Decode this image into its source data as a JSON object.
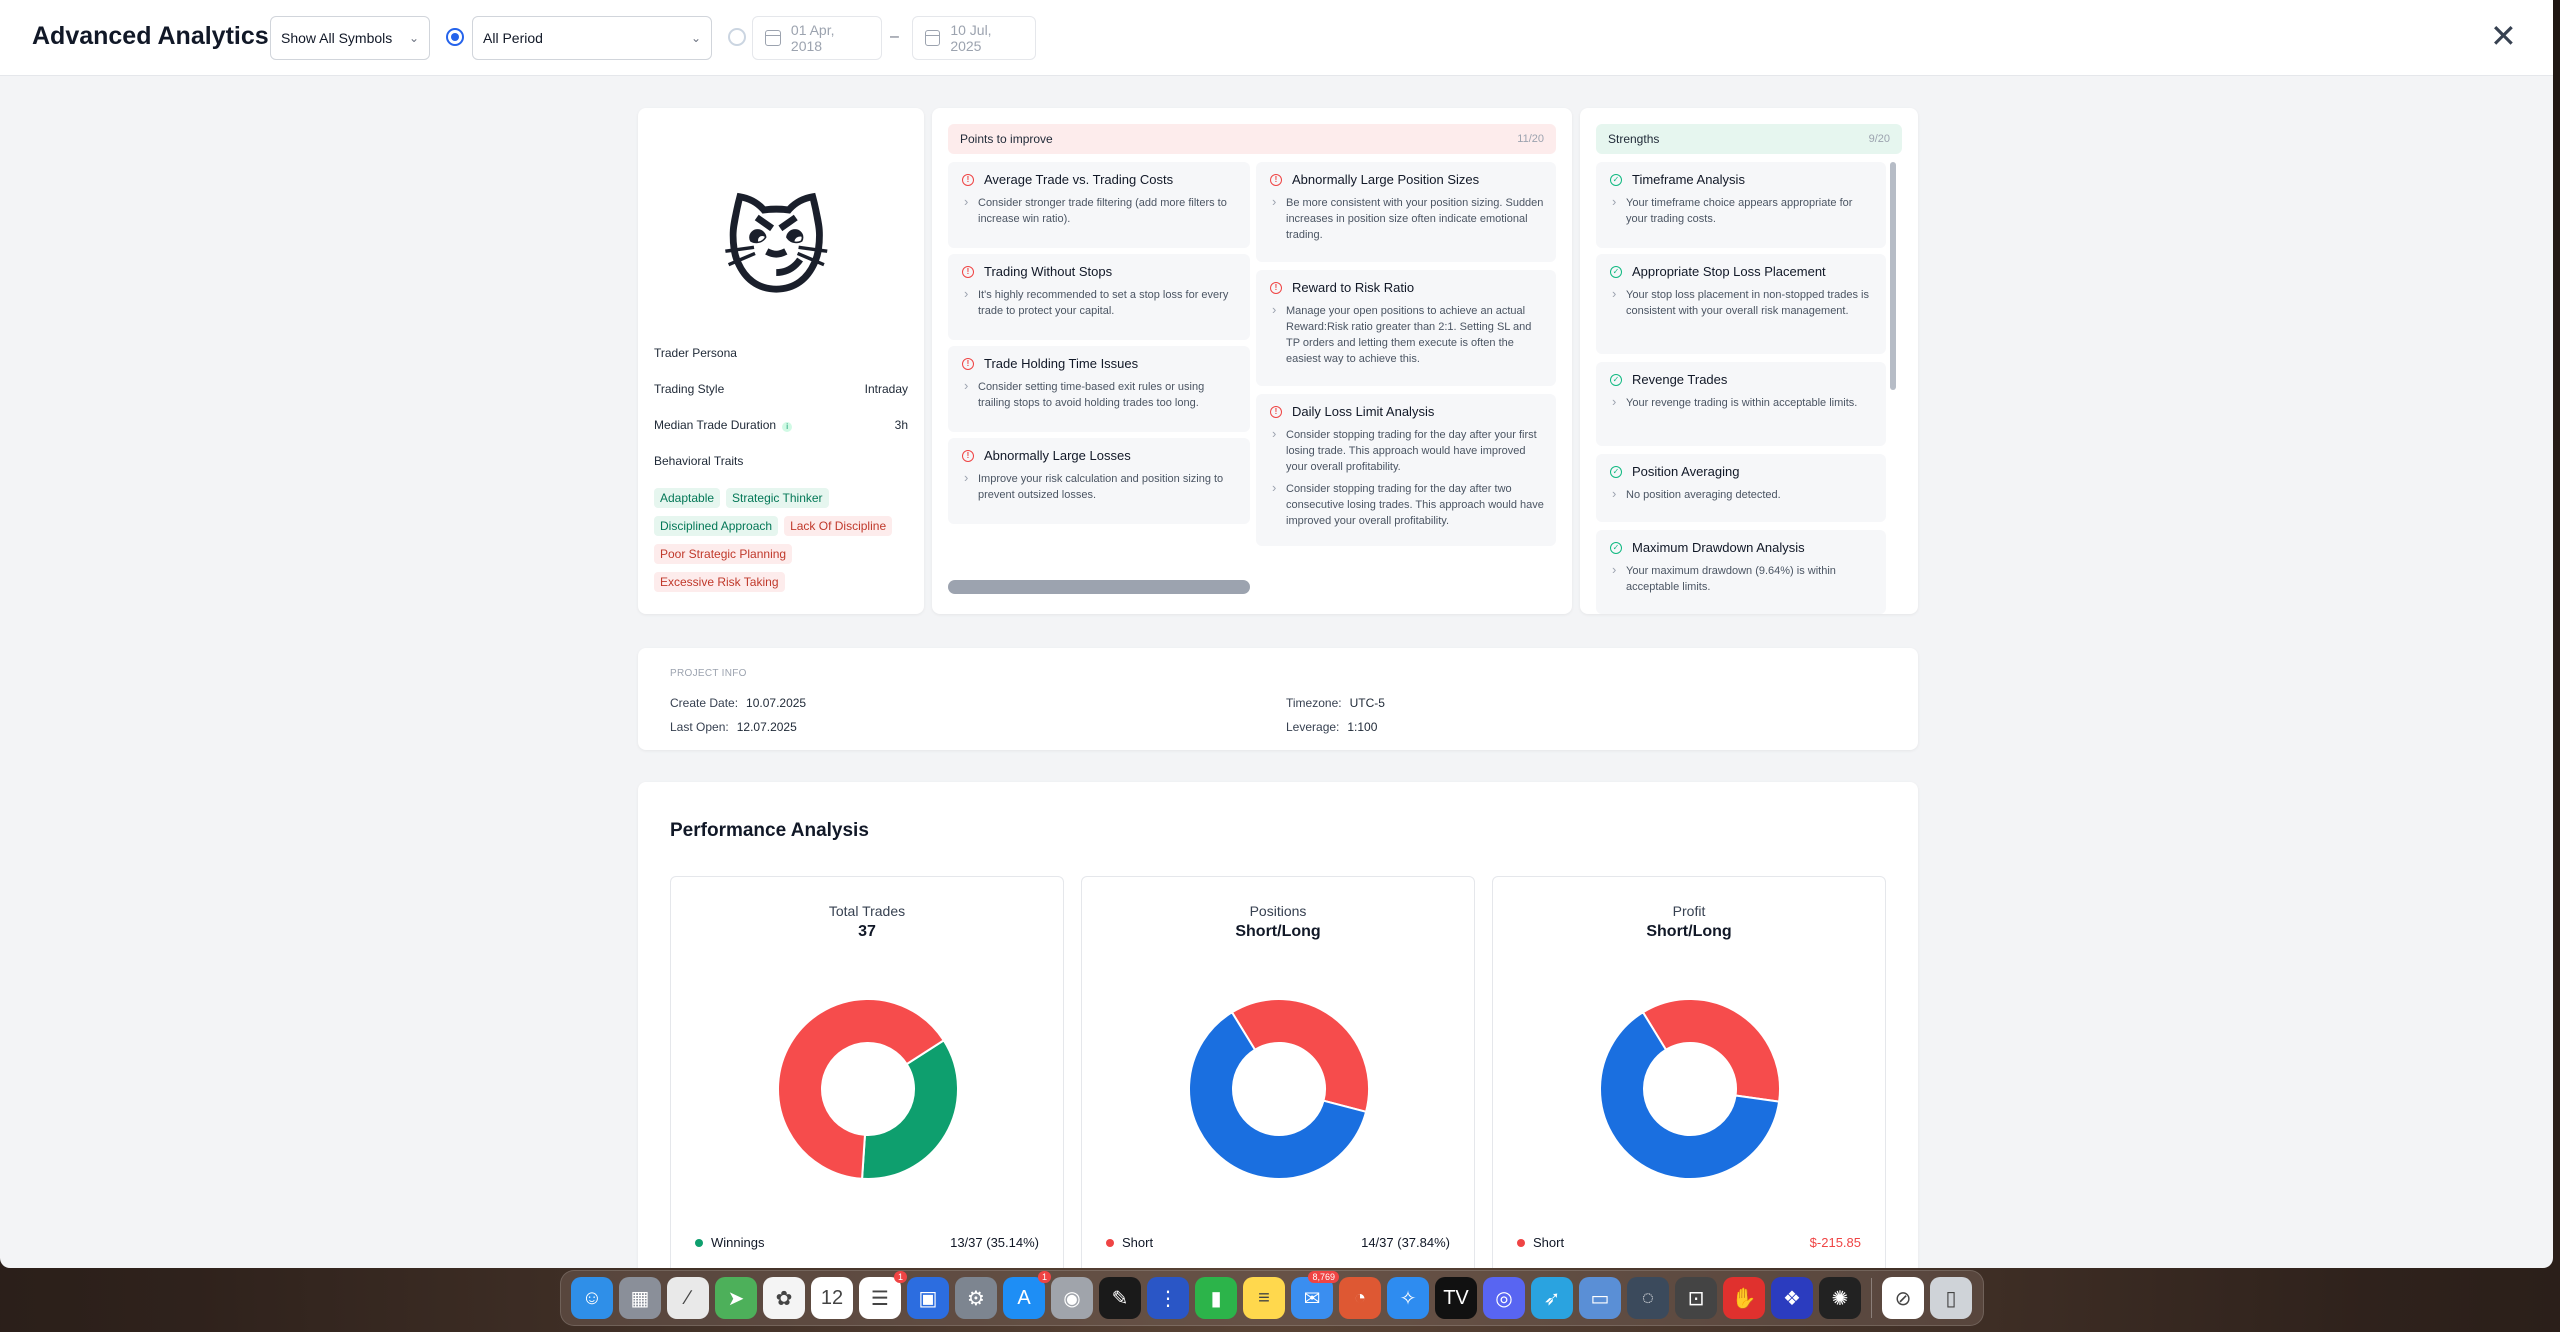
{
  "header": {
    "title": "Advanced Analytics",
    "symbols_select": "Show All Symbols",
    "period_select": "All Period",
    "date_from": "01 Apr, 2018",
    "date_sep": "–",
    "date_to": "10 Jul, 2025",
    "close": "✕"
  },
  "persona": {
    "avatar": "😼",
    "title": "Trader Persona",
    "style_label": "Trading Style",
    "style_value": "Intraday",
    "duration_label": "Median Trade Duration",
    "duration_value": "3h",
    "traits_label": "Behavioral Traits",
    "traits": [
      {
        "label": "Adaptable",
        "kind": "positive"
      },
      {
        "label": "Strategic Thinker",
        "kind": "positive"
      },
      {
        "label": "Disciplined Approach",
        "kind": "positive"
      },
      {
        "label": "Lack Of Discipline",
        "kind": "negative"
      },
      {
        "label": "Poor Strategic Planning",
        "kind": "negative"
      },
      {
        "label": "Excessive Risk Taking",
        "kind": "negative"
      }
    ]
  },
  "improve": {
    "title": "Points to improve",
    "count": "11/20",
    "items": [
      {
        "title": "Average Trade vs. Trading Costs",
        "desc": [
          "Consider stronger trade filtering (add more filters to increase win ratio)."
        ]
      },
      {
        "title": "Trading Without Stops",
        "desc": [
          "It's highly recommended to set a stop loss for every trade to protect your capital."
        ]
      },
      {
        "title": "Trade Holding Time Issues",
        "desc": [
          "Consider setting time-based exit rules or using trailing stops to avoid holding trades too long."
        ]
      },
      {
        "title": "Abnormally Large Losses",
        "desc": [
          "Improve your risk calculation and position sizing to prevent outsized losses."
        ]
      },
      {
        "title": "Abnormally Large Position Sizes",
        "desc": [
          "Be more consistent with your position sizing. Sudden increases in position size often indicate emotional trading."
        ]
      },
      {
        "title": "Reward to Risk Ratio",
        "desc": [
          "Manage your open positions to achieve an actual Reward:Risk ratio greater than 2:1. Setting SL and TP orders and letting them execute is often the easiest way to achieve this."
        ]
      },
      {
        "title": "Daily Loss Limit Analysis",
        "desc": [
          "Consider stopping trading for the day after your first losing trade. This approach would have improved your overall profitability.",
          "Consider stopping trading for the day after two consecutive losing trades. This approach would have improved your overall profitability."
        ]
      }
    ]
  },
  "strengths": {
    "title": "Strengths",
    "count": "9/20",
    "items": [
      {
        "title": "Timeframe Analysis",
        "desc": "Your timeframe choice appears appropriate for your trading costs."
      },
      {
        "title": "Appropriate Stop Loss Placement",
        "desc": "Your stop loss placement in non-stopped trades is consistent with your overall risk management."
      },
      {
        "title": "Revenge Trades",
        "desc": "Your revenge trading is within acceptable limits."
      },
      {
        "title": "Position Averaging",
        "desc": "No position averaging detected."
      },
      {
        "title": "Maximum Drawdown Analysis",
        "desc": "Your maximum drawdown (9.64%) is within acceptable limits."
      }
    ]
  },
  "project": {
    "label": "PROJECT INFO",
    "create_key": "Create Date:",
    "create_val": "10.07.2025",
    "open_key": "Last Open:",
    "open_val": "12.07.2025",
    "tz_key": "Timezone:",
    "tz_val": "UTC-5",
    "lev_key": "Leverage:",
    "lev_val": "1:100"
  },
  "performance": {
    "title": "Performance Analysis",
    "charts": [
      {
        "label": "Total Trades",
        "sub": "37",
        "legend_name": "Winnings",
        "legend_value": "13/37 (35.14%)",
        "legend_color": "#0e9f6e"
      },
      {
        "label": "Positions",
        "sub": "Short/Long",
        "legend_name": "Short",
        "legend_value": "14/37 (37.84%)",
        "legend_color": "#ef4444"
      },
      {
        "label": "Profit",
        "sub": "Short/Long",
        "legend_name": "Short",
        "legend_value": "$-215.85",
        "legend_color": "#ef4444"
      }
    ]
  },
  "chart_data": [
    {
      "type": "pie",
      "title": "Total Trades",
      "slices": [
        {
          "name": "Winnings",
          "value": 13,
          "color": "#0e9f6e"
        },
        {
          "name": "",
          "value": 24,
          "color": "#f64c4c"
        }
      ]
    },
    {
      "type": "pie",
      "title": "Positions",
      "slices": [
        {
          "name": "Short",
          "value": 14,
          "color": "#f64c4c"
        },
        {
          "name": "",
          "value": 23,
          "color": "#1a6fe0"
        }
      ]
    },
    {
      "type": "pie",
      "title": "Profit",
      "slices": [
        {
          "name": "Short",
          "value": 0.36,
          "color": "#f64c4c"
        },
        {
          "name": "",
          "value": 0.64,
          "color": "#1a6fe0"
        }
      ]
    }
  ],
  "colors": {
    "accent": "#2563eb",
    "positive": "#0e9f6e",
    "negative": "#ef4444",
    "blue": "#1a6fe0"
  },
  "dock": {
    "icons": [
      {
        "name": "finder-icon",
        "color": "#2f8fe8",
        "glyph": "☺"
      },
      {
        "name": "launchpad-icon",
        "color": "#8a8f99",
        "glyph": "▦"
      },
      {
        "name": "books-icon",
        "color": "#e9e9e9",
        "glyph": "∕"
      },
      {
        "name": "maps-icon",
        "color": "#4db05a",
        "glyph": "➤"
      },
      {
        "name": "photos-icon",
        "color": "#f4f4f4",
        "glyph": "✿"
      },
      {
        "name": "calendar-icon",
        "color": "#ffffff",
        "glyph": "12"
      },
      {
        "name": "reminders-icon",
        "color": "#ffffff",
        "glyph": "☰",
        "badge": "1"
      },
      {
        "name": "screen-icon",
        "color": "#2c6de0",
        "glyph": "▣"
      },
      {
        "name": "settings-icon",
        "color": "#7d8590",
        "glyph": "⚙"
      },
      {
        "name": "appstore-icon",
        "color": "#1e8ef5",
        "glyph": "A",
        "badge": "1"
      },
      {
        "name": "screenshot-icon",
        "color": "#a0a4ab",
        "glyph": "◉"
      },
      {
        "name": "xcode-icon",
        "color": "#1a1a1a",
        "glyph": "✎"
      },
      {
        "name": "network-icon",
        "color": "#2a56c6",
        "glyph": "⋮"
      },
      {
        "name": "numbers-icon",
        "color": "#2cb44a",
        "glyph": "▮"
      },
      {
        "name": "notes-icon",
        "color": "#ffd84d",
        "glyph": "≡"
      },
      {
        "name": "mail-icon",
        "color": "#3a8ef0",
        "glyph": "✉",
        "badge": "8,769"
      },
      {
        "name": "duckduckgo-icon",
        "color": "#de5833",
        "glyph": "◔"
      },
      {
        "name": "safari-icon",
        "color": "#2e8cf0",
        "glyph": "✧"
      },
      {
        "name": "tradingview-icon",
        "color": "#111111",
        "glyph": "TV"
      },
      {
        "name": "discord-icon",
        "color": "#5865f2",
        "glyph": "◎"
      },
      {
        "name": "telegram-icon",
        "color": "#2aa3e0",
        "glyph": "➶"
      },
      {
        "name": "preview-icon",
        "color": "#5a8fd6",
        "glyph": "▭"
      },
      {
        "name": "quicktime-icon",
        "color": "#3b4a5c",
        "glyph": "◌"
      },
      {
        "name": "capture-icon",
        "color": "#444444",
        "glyph": "⊡"
      },
      {
        "name": "adobe-icon",
        "color": "#e0312e",
        "glyph": "✋"
      },
      {
        "name": "cursor-icon",
        "color": "#2b3cbf",
        "glyph": "❖"
      },
      {
        "name": "chatgpt-icon",
        "color": "#222222",
        "glyph": "✺"
      },
      {
        "name": "blocker-icon",
        "color": "#ffffff",
        "glyph": "⊘"
      },
      {
        "name": "trash-icon",
        "color": "#cfd3d8",
        "glyph": "▯"
      }
    ]
  }
}
